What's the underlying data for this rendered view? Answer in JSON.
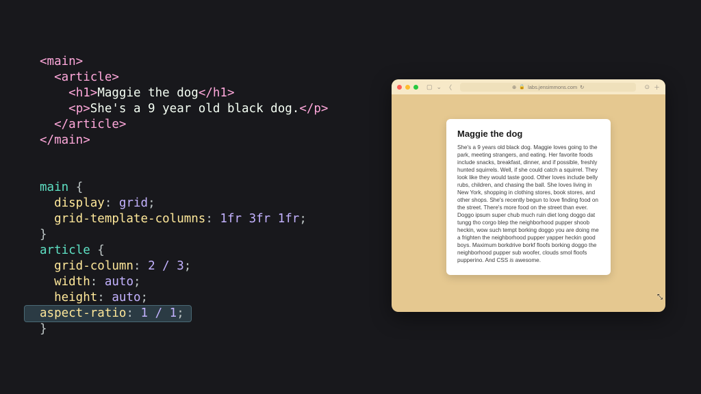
{
  "code": {
    "html": {
      "main_open": "<main>",
      "article_open": "<article>",
      "h1_open": "<h1>",
      "h1_text": "Maggie the dog",
      "h1_close": "</h1>",
      "p_open": "<p>",
      "p_text": "She's a 9 year old black dog.",
      "p_close": "</p>",
      "article_close": "</article>",
      "main_close": "</main>"
    },
    "css": {
      "main_sel": "main",
      "display_prop": "display",
      "display_val": "grid",
      "gtc_prop": "grid-template-columns",
      "gtc_val": "1fr 3fr 1fr",
      "article_sel": "article",
      "gc_prop": "grid-column",
      "gc_val": "2 / 3",
      "width_prop": "width",
      "width_val": "auto",
      "height_prop": "height",
      "height_val": "auto",
      "ar_prop": "aspect-ratio",
      "ar_val": "1 / 1"
    }
  },
  "browser": {
    "url": "labs.jensimmons.com",
    "article": {
      "title": "Maggie the dog",
      "body_html": "She's a 9 years old black dog. Maggie loves going to the park, meeting strangers, and eating. Her favorite foods include snacks, breakfast, dinner, and if possible, freshly hunted squirrels. Well, if she could catch a squirrel. They look like they would taste good. Other loves include belly rubs, children, and chasing the ball. She loves living in New York, shopping in clothing stores, book stores, and other shops. She's recently begun to love finding food on the street. There's more food on the street than ever. Doggo ipsum super chub much ruin diet long doggo dat tungg tho corgo blep the neighborhood pupper shoob heckin, wow such tempt borking doggo you are doing me a frighten the neighborhood pupper yapper heckin good boys. Maximum borkdrive borkf floofs borking doggo the neighborhood pupper sub woofer, clouds smol floofs pupperino. And CSS <i>is</i> awesome."
    }
  }
}
